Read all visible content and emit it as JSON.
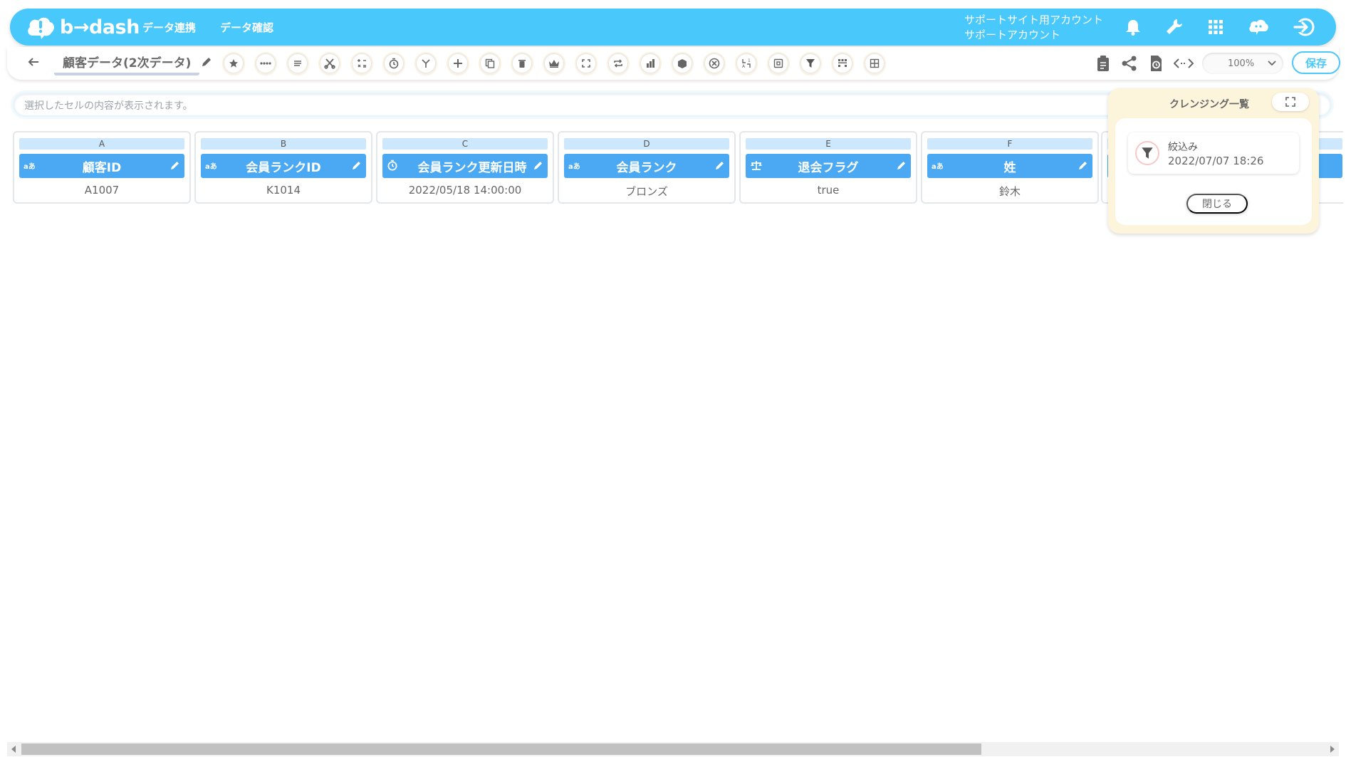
{
  "app": {
    "logo_text": "b→dash"
  },
  "nav": {
    "items": [
      "データ連携",
      "データ確認"
    ]
  },
  "account": {
    "company": "サポートサイト用アカウント",
    "user": "サポートアカウント"
  },
  "toolbar": {
    "title": "顧客データ(2次データ)",
    "zoom": "100%",
    "save_label": "保存"
  },
  "cellbar": {
    "placeholder": "選択したセルの内容が表示されます。"
  },
  "columns": [
    {
      "letter": "A",
      "type": "aあ",
      "name": "顧客ID",
      "value": "A1007"
    },
    {
      "letter": "B",
      "type": "aあ",
      "name": "会員ランクID",
      "value": "K1014"
    },
    {
      "letter": "C",
      "type": "clock",
      "name": "会員ランク更新日時",
      "value": "2022/05/18 14:00:00"
    },
    {
      "letter": "D",
      "type": "aあ",
      "name": "会員ランク",
      "value": "ブロンズ"
    },
    {
      "letter": "E",
      "type": "boolean",
      "name": "退会フラグ",
      "value": "true"
    },
    {
      "letter": "F",
      "type": "aあ",
      "name": "姓",
      "value": "鈴木"
    }
  ],
  "cleansing_panel": {
    "title": "クレンジング一覧",
    "items": [
      {
        "name": "絞込み",
        "date": "2022/07/07 18:26",
        "icon": "filter-icon"
      }
    ],
    "close_label": "閉じる"
  },
  "colors": {
    "brand": "#49c8fb",
    "column_header": "#4aa9f2",
    "panel_bg": "#fdf4dc"
  }
}
